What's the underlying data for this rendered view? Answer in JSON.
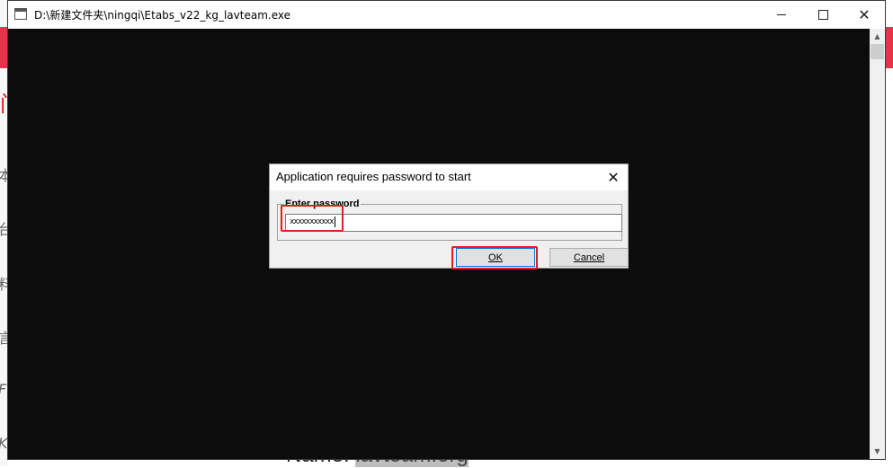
{
  "window": {
    "title": "D:\\新建文件夹\\ningqi\\Etabs_v22_kg_lavteam.exe",
    "minimize_icon": "minimize-icon",
    "maximize_icon": "maximize-icon",
    "close_glyph": "✕"
  },
  "background": {
    "left_chars": [
      "门",
      "本",
      "台",
      "料",
      "言",
      "F",
      "K"
    ],
    "bottom_label": "Name: ",
    "bottom_value": "lavteam.org"
  },
  "dialog": {
    "title": "Application requires password to start",
    "close_glyph": "✕",
    "group_label": "Enter password",
    "password_value": "xxxxxxxxxxx",
    "ok_label": "OK",
    "cancel_label": "Cancel"
  },
  "colors": {
    "console_bg": "#0c0c0c",
    "highlight": "#e02020",
    "accent": "#e8324a"
  }
}
